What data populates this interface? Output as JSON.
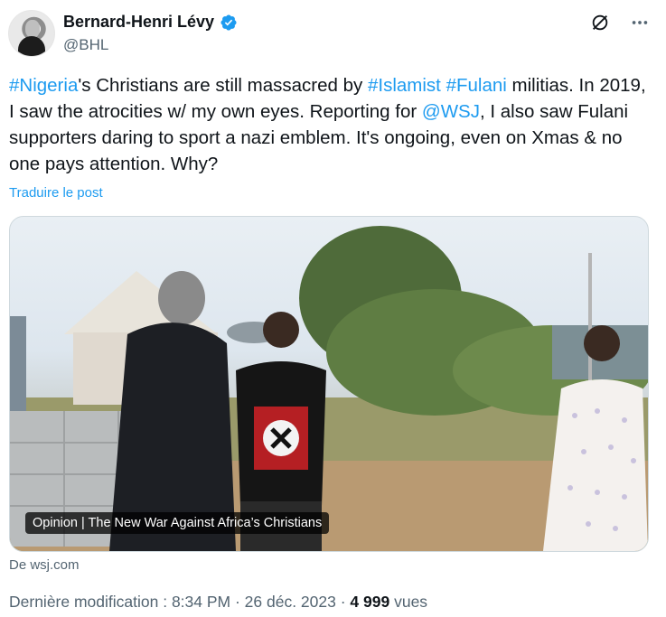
{
  "author": {
    "name": "Bernard-Henri Lévy",
    "handle": "@BHL"
  },
  "tweet": {
    "segments": [
      {
        "text": "#Nigeria",
        "type": "link"
      },
      {
        "text": "'s Christians are still massacred by ",
        "type": "text"
      },
      {
        "text": "#Islamist",
        "type": "link"
      },
      {
        "text": " ",
        "type": "text"
      },
      {
        "text": "#Fulani",
        "type": "link"
      },
      {
        "text": " militias. In 2019, I saw the atrocities w/ my own eyes. Reporting for ",
        "type": "text"
      },
      {
        "text": "@WSJ",
        "type": "link"
      },
      {
        "text": ", I also saw Fulani supporters daring to sport a nazi emblem. It's ongoing, even on Xmas & no one pays attention. Why?",
        "type": "text"
      }
    ],
    "translate_label": "Traduire le post"
  },
  "media": {
    "caption": "Opinion | The New War Against Africa’s Christians",
    "source": "De wsj.com"
  },
  "meta": {
    "label": "Dernière modification : 8:34 PM · 26 déc. 2023 · ",
    "views_count": "4 999",
    "views_label": " vues"
  },
  "icons": {
    "verified": "verified-badge-icon",
    "grok": "grok-icon",
    "more": "more-icon"
  },
  "colors": {
    "link": "#1d9bf0",
    "secondary_text": "#536471",
    "primary_text": "#0f1419"
  }
}
